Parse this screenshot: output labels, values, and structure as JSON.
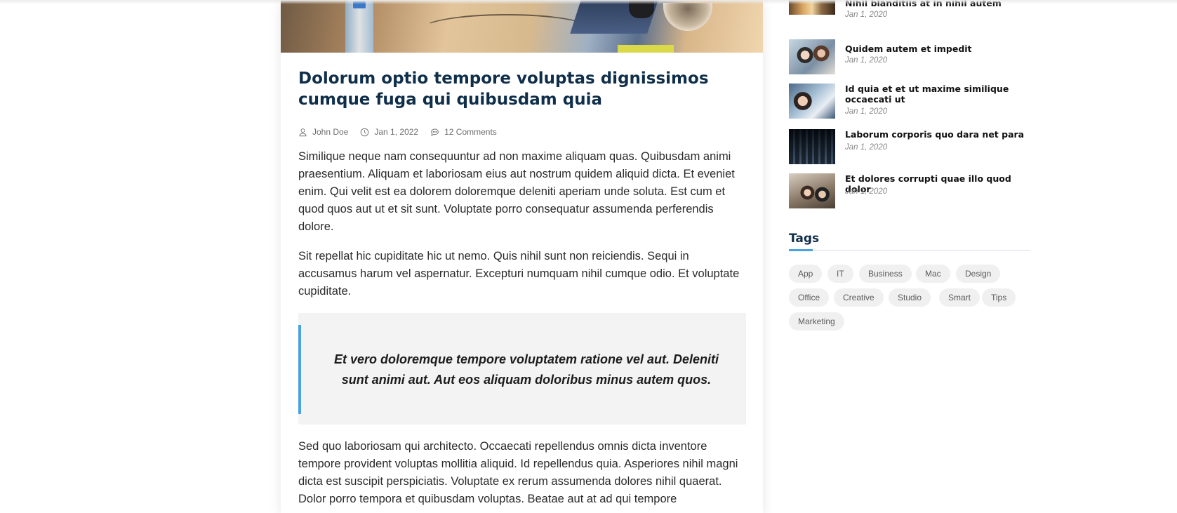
{
  "post": {
    "title": "Dolorum optio tempore voluptas dignissimos cumque fuga qui quibusdam quia",
    "meta": {
      "author": "John Doe",
      "date": "Jan 1, 2022",
      "comments": "12 Comments"
    },
    "paragraph_1": "Similique neque nam consequuntur ad non maxime aliquam quas. Quibusdam animi praesentium. Aliquam et laboriosam eius aut nostrum quidem aliquid dicta. Et eveniet enim. Qui velit est ea dolorem doloremque deleniti aperiam unde soluta. Est cum et quod quos aut ut et sit sunt. Voluptate porro consequatur assumenda perferendis dolore.",
    "paragraph_2": "Sit repellat hic cupiditate hic ut nemo. Quis nihil sunt non reiciendis. Sequi in accusamus harum vel aspernatur. Excepturi numquam nihil cumque odio. Et voluptate cupiditate.",
    "blockquote": "Et vero doloremque tempore voluptatem ratione vel aut. Deleniti sunt animi aut. Aut eos aliquam doloribus minus autem quos.",
    "paragraph_3": "Sed quo laboriosam qui architecto. Occaecati repellendus omnis dicta inventore tempore provident voluptas mollitia aliquid. Id repellendus quia. Asperiores nihil magni dicta est suscipit perspiciatis. Voluptate ex rerum assumenda dolores nihil quaerat. Dolor porro tempora et quibusdam voluptas. Beatae aut at ad qui tempore"
  },
  "sidebar": {
    "recent_posts": [
      {
        "title": "Nihil blanditiis at in nihil autem",
        "date": "Jan 1, 2020"
      },
      {
        "title": "Quidem autem et impedit",
        "date": "Jan 1, 2020"
      },
      {
        "title": "Id quia et et ut maxime similique occaecati ut",
        "date": "Jan 1, 2020"
      },
      {
        "title": "Laborum corporis quo dara net para",
        "date": "Jan 1, 2020"
      },
      {
        "title": "Et dolores corrupti quae illo quod dolor",
        "date": "Jan 1, 2020"
      }
    ],
    "tags_title": "Tags",
    "tags": [
      "App",
      "IT",
      "Business",
      "Mac",
      "Design",
      "Office",
      "Creative",
      "Studio",
      "Smart",
      "Tips",
      "Marketing"
    ]
  },
  "colors": {
    "heading": "#0f2e4a",
    "accent": "#4aa3df",
    "tag_bg": "#f0f0f0"
  },
  "icons": {
    "author": "person-icon",
    "date": "clock-icon",
    "comments": "comment-icon"
  }
}
